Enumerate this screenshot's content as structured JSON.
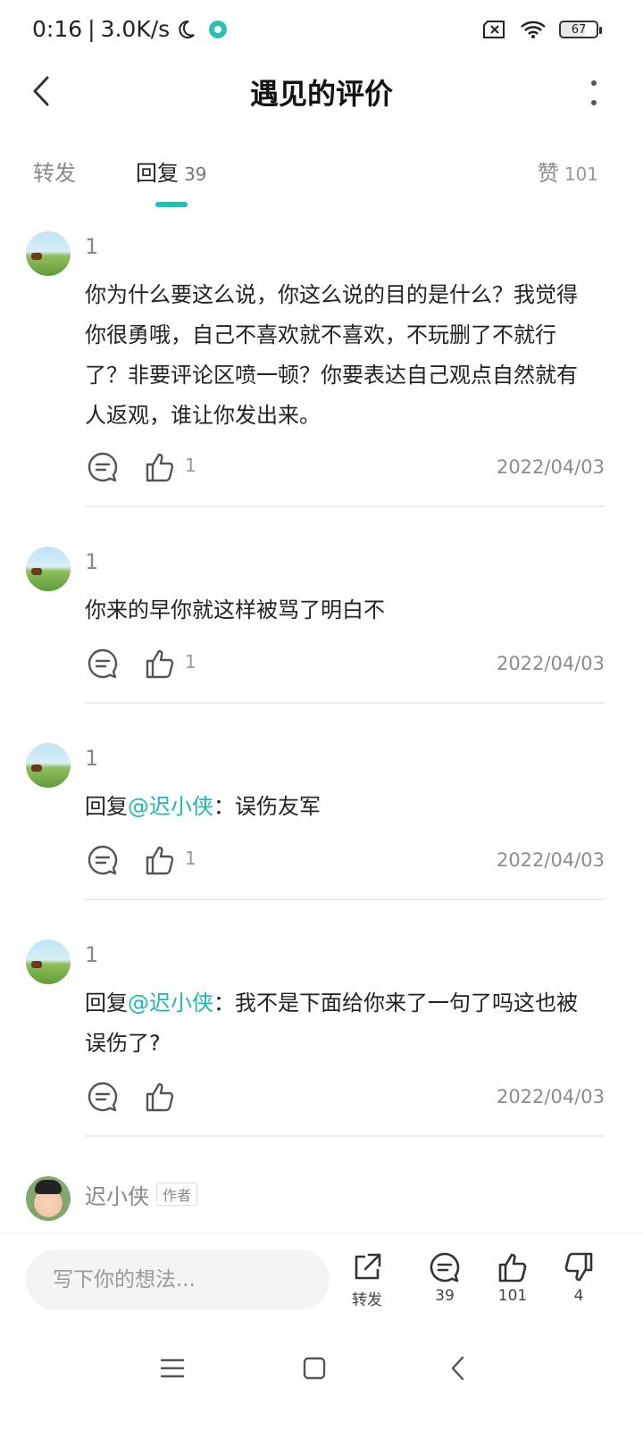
{
  "status_bar": {
    "time": "0:16",
    "speed": "3.0K/s",
    "battery": "67"
  },
  "header": {
    "title": "遇见的评价"
  },
  "tabs": {
    "repost_label": "转发",
    "reply_label": "回复",
    "reply_count": "39",
    "like_label": "赞",
    "like_count": "101"
  },
  "comments": [
    {
      "name": "1",
      "text": "你为什么要这么说，你这么说的目的是什么？我觉得你很勇哦，自己不喜欢就不喜欢，不玩删了不就行了？非要评论区喷一顿？你要表达自己观点自然就有人返观，谁让你发出来。",
      "likes": "1",
      "date": "2022/04/03"
    },
    {
      "name": "1",
      "text": "你来的早你就这样被骂了明白不",
      "likes": "1",
      "date": "2022/04/03"
    },
    {
      "name": "1",
      "reply_prefix": "回复",
      "mention": "@迟小侠",
      "text": "：误伤友军",
      "likes": "1",
      "date": "2022/04/03"
    },
    {
      "name": "1",
      "reply_prefix": "回复",
      "mention": "@迟小侠",
      "text": "：我不是下面给你来了一句了吗这也被误伤了?",
      "likes": "",
      "date": "2022/04/03"
    },
    {
      "name": "迟小侠",
      "tag": "作者"
    }
  ],
  "bottom_bar": {
    "input_placeholder": "写下你的想法...",
    "repost_label": "转发",
    "comment_count": "39",
    "like_count": "101",
    "dislike_count": "4"
  },
  "colors": {
    "accent": "#1fb7b1",
    "text": "#222222",
    "secondary": "#8c8c8c"
  },
  "icons": [
    "back-arrow-icon",
    "more-vertical-icon",
    "comment-icon",
    "thumbs-up-icon",
    "share-icon",
    "thumbs-down-icon",
    "menu-icon",
    "home-square-icon",
    "nav-back-icon"
  ]
}
